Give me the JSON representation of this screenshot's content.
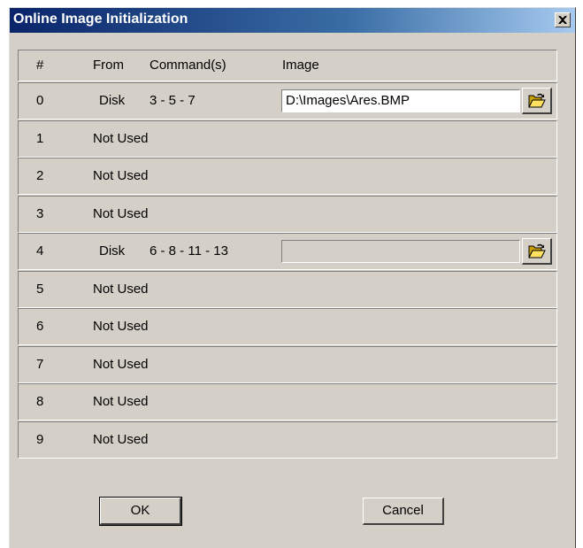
{
  "window": {
    "title": "Online Image Initialization",
    "close_glyph": "✕"
  },
  "columns": {
    "num": "#",
    "from": "From",
    "commands": "Command(s)",
    "image": "Image"
  },
  "rows": [
    {
      "num": "0",
      "from": "Disk",
      "commands": "3 - 5 - 7",
      "image": "D:\\Images\\Ares.BMP",
      "has_image_field": true
    },
    {
      "num": "1",
      "from": "Not Used",
      "commands": "",
      "image": "",
      "has_image_field": false
    },
    {
      "num": "2",
      "from": "Not Used",
      "commands": "",
      "image": "",
      "has_image_field": false
    },
    {
      "num": "3",
      "from": "Not Used",
      "commands": "",
      "image": "",
      "has_image_field": false
    },
    {
      "num": "4",
      "from": "Disk",
      "commands": "6 - 8 - 11 - 13",
      "image": "",
      "has_image_field": true
    },
    {
      "num": "5",
      "from": "Not Used",
      "commands": "",
      "image": "",
      "has_image_field": false
    },
    {
      "num": "6",
      "from": "Not Used",
      "commands": "",
      "image": "",
      "has_image_field": false
    },
    {
      "num": "7",
      "from": "Not Used",
      "commands": "",
      "image": "",
      "has_image_field": false
    },
    {
      "num": "8",
      "from": "Not Used",
      "commands": "",
      "image": "",
      "has_image_field": false
    },
    {
      "num": "9",
      "from": "Not Used",
      "commands": "",
      "image": "",
      "has_image_field": false
    }
  ],
  "buttons": {
    "ok": "OK",
    "cancel": "Cancel"
  },
  "icons": {
    "browse": "open-folder-icon",
    "close": "close-icon"
  },
  "colors": {
    "title_gradient_start": "#0a246a",
    "title_gradient_end": "#a6caf0",
    "face": "#d4d0c8"
  }
}
